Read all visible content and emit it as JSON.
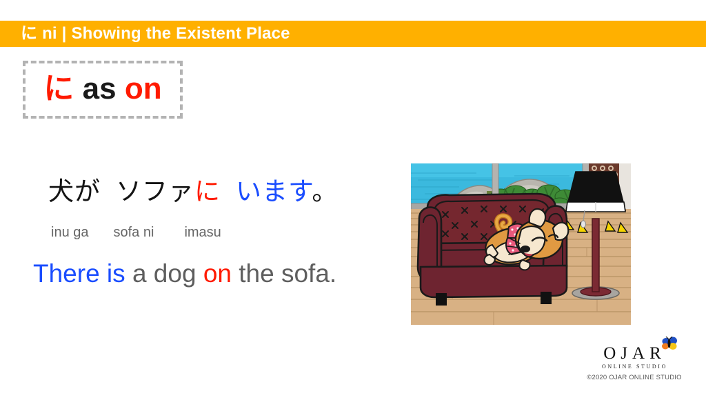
{
  "header": {
    "title": "に ni | Showing the Existent Place",
    "bar_color": "#ffb000",
    "text_color": "#ffffff"
  },
  "title_box": {
    "particle": "に",
    "connector": "as",
    "meaning": "on",
    "border_color": "#b3b3b3",
    "accent_color": "#ff1a00"
  },
  "example": {
    "japanese": {
      "subject": "犬が",
      "place": "ソファ",
      "particle": "に",
      "verb": "います",
      "period": "。"
    },
    "romaji": {
      "subject": "inu ga",
      "place": "sofa ni",
      "verb": "imasu"
    },
    "english": {
      "verb_phrase": "There is",
      "subject": "a dog",
      "preposition": "on",
      "object": "the sofa."
    },
    "colors": {
      "black": "#141414",
      "red": "#ff1a00",
      "blue": "#1a4dff",
      "gray": "#5e5e5e",
      "romaji_gray": "#666666"
    }
  },
  "illustration": {
    "name": "dog-on-sofa-illustration",
    "description": "A sleeping orange dog wearing a pink bandana lies on a dark red tufted sofa in a wooden-floored room; a floor lamp stands to the right and a window shows the ocean and green plants.",
    "colors": {
      "sofa": "#6e2430",
      "dog": "#e09a42",
      "bandana": "#e8597c",
      "floor": "#d6b183",
      "sky_water": "#3bb9de",
      "foliage": "#3e8b36",
      "lamp_shade": "#111111",
      "lamp_pole": "#7b2a33"
    }
  },
  "footer": {
    "logo_word": "OJAR",
    "logo_letters": [
      "O",
      "J",
      "A",
      "R"
    ],
    "logo_subtitle": "ONLINE STUDIO",
    "copyright": "©2020 OJAR ONLINE STUDIO",
    "butterfly_colors": [
      "#1f4fc4",
      "#f07c1e",
      "#f5c518",
      "#111111"
    ]
  }
}
